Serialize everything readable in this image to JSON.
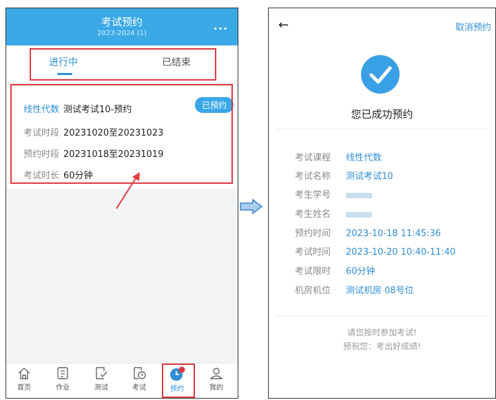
{
  "left": {
    "header": {
      "title": "考试预约",
      "subtitle": "2023-2024 (1)",
      "more": "..."
    },
    "tabs": [
      {
        "label": "进行中"
      },
      {
        "label": "已结束"
      }
    ],
    "card": {
      "course": "线性代数",
      "exam_name": "测试考试10-预约",
      "badge": "已预约",
      "rows": [
        {
          "label": "考试时段",
          "value": "20231020至20231023"
        },
        {
          "label": "预约时段",
          "value": "20231018至20231019"
        },
        {
          "label": "考试时长",
          "value": "60分钟"
        }
      ]
    },
    "nav": [
      {
        "label": "首页",
        "icon": "home-icon"
      },
      {
        "label": "作业",
        "icon": "homework-icon"
      },
      {
        "label": "测试",
        "icon": "test-icon"
      },
      {
        "label": "考试",
        "icon": "exam-icon"
      },
      {
        "label": "预约",
        "icon": "booking-clock-icon",
        "active": true
      },
      {
        "label": "我的",
        "icon": "user-icon"
      }
    ]
  },
  "right": {
    "back": "←",
    "cancel": "取消预约",
    "success": "您已成功预约",
    "info": [
      {
        "label": "考试课程",
        "value": "线性代数"
      },
      {
        "label": "考试名称",
        "value": "测试考试10"
      },
      {
        "label": "考生学号",
        "value": ""
      },
      {
        "label": "考生姓名",
        "value": ""
      },
      {
        "label": "预约时间",
        "value": "2023-10-18 11:45:36"
      },
      {
        "label": "考试时间",
        "value": "2023-10-20 10:40-11:40"
      },
      {
        "label": "考试限时",
        "value": "60分钟"
      },
      {
        "label": "机房机位",
        "value": "测试机房 08号位"
      }
    ],
    "note1": "请您按时参加考试!",
    "note2": "预祝您：考出好成绩!"
  },
  "colors": {
    "primary": "#3aa9e6",
    "accent": "#2f8fd8",
    "annotation": "#e0393e"
  }
}
